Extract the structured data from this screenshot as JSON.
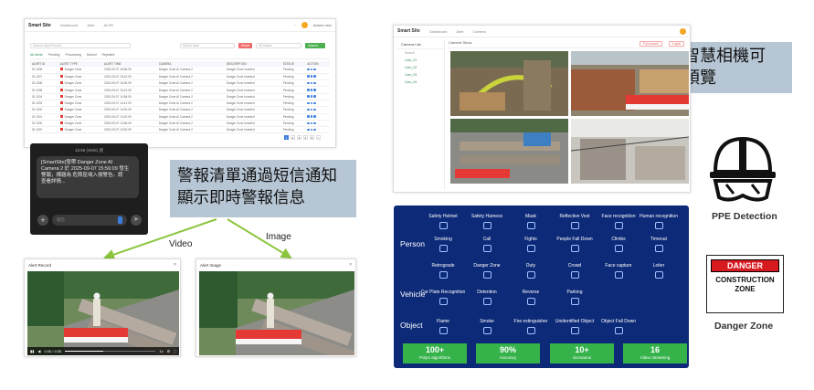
{
  "alert_list": {
    "brand": "Smart Site",
    "nav": [
      "Dashboard",
      "Alert",
      "AI/VR"
    ],
    "user_name": "Admin user",
    "search_placeholder": "Search Alert Record",
    "filter_placeholder": "Select Date",
    "filter_select": "All status",
    "reset_label": "Reset",
    "confirm_label": "Search",
    "tabs": [
      "All Alerts",
      "Pending",
      "Processing",
      "Solved",
      "Rejected"
    ],
    "columns": [
      "ALERT ID",
      "ALERT TYPE",
      "ALERT TIME",
      "CAMERA",
      "DESCRIPTION",
      "STATUS",
      "ACTION"
    ],
    "rows": [
      [
        "ID.1208",
        "Danger Zone",
        "2025-09-07 15:56:09",
        "Danger Zone AI Camera 2",
        "Danger Zone Invaded",
        "Pending"
      ],
      [
        "ID.1207",
        "Danger Zone",
        "2025-09-07 15:42:09",
        "Danger Zone AI Camera 2",
        "Danger Zone Invaded",
        "Pending"
      ],
      [
        "ID.1206",
        "Danger Zone",
        "2025-09-07 15:30:09",
        "Danger Zone AI Camera 2",
        "Danger Zone Invaded",
        "Pending"
      ],
      [
        "ID.1205",
        "Danger Zone",
        "2025-09-07 15:12:09",
        "Danger Zone AI Camera 2",
        "Danger Zone Invaded",
        "Pending"
      ],
      [
        "ID.1204",
        "Danger Zone",
        "2025-09-07 14:58:09",
        "Danger Zone AI Camera 2",
        "Danger Zone Invaded",
        "Pending"
      ],
      [
        "ID.1203",
        "Danger Zone",
        "2025-09-07 14:41:09",
        "Danger Zone AI Camera 2",
        "Danger Zone Invaded",
        "Pending"
      ],
      [
        "ID.1202",
        "Danger Zone",
        "2025-09-07 14:20:09",
        "Danger Zone AI Camera 2",
        "Danger Zone Invaded",
        "Pending"
      ],
      [
        "ID.1201",
        "Danger Zone",
        "2025-09-07 14:02:09",
        "Danger Zone AI Camera 2",
        "Danger Zone Invaded",
        "Pending"
      ],
      [
        "ID.1200",
        "Danger Zone",
        "2025-09-07 13:48:09",
        "Danger Zone AI Camera 2",
        "Danger Zone Invaded",
        "Pending"
      ],
      [
        "ID.1199",
        "Danger Zone",
        "2025-09-07 13:30:09",
        "Danger Zone AI Camera 2",
        "Danger Zone Invaded",
        "Pending"
      ]
    ],
    "pages": [
      "1",
      "2",
      "3",
      "4",
      "5",
      ">"
    ]
  },
  "phone": {
    "time": "15:56 (SMS) 週",
    "message": "[SmartSite]發帶 Danger Zone AI\nCamera 2 於 2025-09-07 15:56:09 發生\n警報，標題為 危險區域入侵警告。請\n查看詳情...",
    "input_placeholder": "短信"
  },
  "captions": {
    "alert_caption": "警報清單通過短信通知顯示即時警報信息",
    "preview_caption": "所有智慧相機可即時預覽",
    "video_arrow": "Video",
    "image_arrow": "Image"
  },
  "video_popup": {
    "title": "Alert Record",
    "close": "×",
    "time": "0:00 / 0:30",
    "speed": "1x",
    "progress": 0.42
  },
  "image_popup": {
    "title": "Alert Image",
    "close": "×"
  },
  "live_preview": {
    "brand": "Smart Site",
    "nav": [
      "Dashboard",
      "Alert",
      "Camera"
    ],
    "sidebar_title": "Camera List",
    "sidebar_sub": "Search",
    "cameras": [
      "Cam_01",
      "Cam_02",
      "Cam_03",
      "Cam_04"
    ],
    "main_title": "Camera Show",
    "btn_a": "Full screen",
    "btn_b": "4-split"
  },
  "algo": {
    "sections": [
      "Person",
      "Vehicle",
      "Object"
    ],
    "person_row1": [
      "Safety Helmet",
      "Safety Harness",
      "Mask",
      "Reflective Vest",
      "Face recognition",
      "Human recognition"
    ],
    "person_row2": [
      "Smoking",
      "Call",
      "Fights",
      "People Fall Down",
      "Climbs",
      "Timeout"
    ],
    "person_row3": [
      "Retrograde",
      "Danger Zone",
      "Duty",
      "Crowd",
      "Face capture",
      "Loiter"
    ],
    "vehicle": [
      "Car Plate Recognition",
      "Detention",
      "Reverse",
      "Parking"
    ],
    "object": [
      "Flame",
      "Smoke",
      "Fire extinguisher",
      "Unidentified Object",
      "Object Fall Down"
    ],
    "stats": [
      {
        "value": "100+",
        "label": "PolyU algorithms"
      },
      {
        "value": "90%",
        "label": "Accuracy"
      },
      {
        "value": "10+",
        "label": "Scenarios"
      },
      {
        "value": "16",
        "label": "Video streaming"
      }
    ]
  },
  "right_panel": {
    "ppe_label": "PPE Detection",
    "danger_top": "DANGER",
    "danger_bottom_1": "CONSTRUCTION",
    "danger_bottom_2": "ZONE",
    "danger_label": "Danger Zone"
  },
  "colors": {
    "caption_bg": "#b7c6d4",
    "panel_bg": "#0d2a78",
    "stat_green": "#35b24a",
    "danger_red": "#d71920",
    "arrow_green": "#8cc63f"
  }
}
